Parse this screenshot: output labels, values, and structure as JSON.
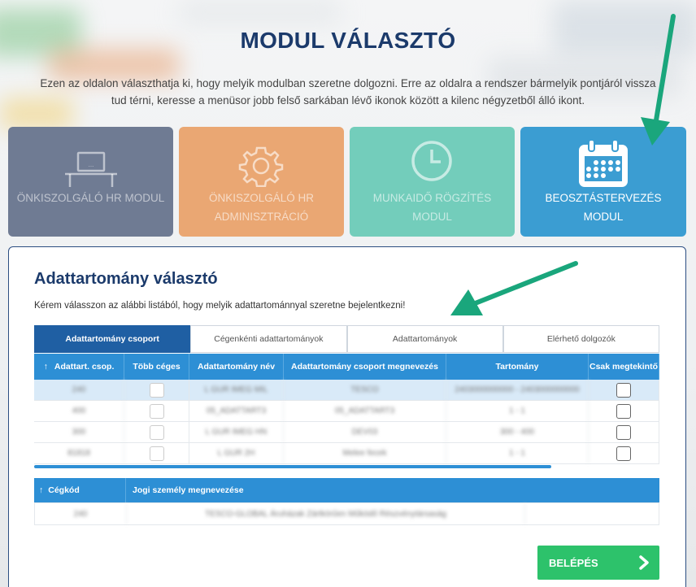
{
  "page": {
    "title": "MODUL VÁLASZTÓ",
    "subtitle": "Ezen az oldalon választhatja ki, hogy melyik modulban szeretne dolgozni. Erre az oldalra a rendszer bármelyik pontjáról vissza tud térni, keresse a menüsor jobb felső sarkában lévő ikonok között a kilenc négyzetből álló ikont."
  },
  "modules": [
    {
      "label": "ÖNKISZOLGÁLÓ HR MODUL",
      "icon": "workstation-icon",
      "color": "#6f7b93"
    },
    {
      "label": "ÖNKISZOLGÁLÓ HR ADMINISZTRÁCIÓ",
      "icon": "gear-icon",
      "color": "#eaa773"
    },
    {
      "label": "MUNKAIDŐ RÖGZÍTÉS MODUL",
      "icon": "clock-icon",
      "color": "#73cdbb"
    },
    {
      "label": "BEOSZTÁSTERVEZÉS MODUL",
      "icon": "calendar-icon",
      "color": "#3b9dd2"
    }
  ],
  "panel": {
    "title": "Adattartomány választó",
    "description": "Kérem válasszon az alábbi listából, hogy melyik adattartománnyal szeretne bejelentkezni!"
  },
  "tabs": [
    {
      "label": "Adattartomány csoport",
      "active": true
    },
    {
      "label": "Cégenkénti adattartományok",
      "active": false
    },
    {
      "label": "Adattartományok",
      "active": false
    },
    {
      "label": "Elérhető dolgozók",
      "active": false
    }
  ],
  "grid": {
    "sort_icon": "↑",
    "columns": [
      "Adattart. csop.",
      "Több céges",
      "Adattartomány név",
      "Adattartomány csoport megnevezés",
      "Tartomány",
      "Csak megtekintő"
    ],
    "rows": [
      {
        "code": "240",
        "name": "L GUR IMEG MIL",
        "group": "TESCO",
        "range": "2403000000000 - 2403000000000"
      },
      {
        "code": "400",
        "name": "05_ADATTART3",
        "group": "05_ADATTART3",
        "range": "1 - 1"
      },
      {
        "code": "300",
        "name": "L GUR IMEG HN",
        "group": "DEV03",
        "range": "300 - 400"
      },
      {
        "code": "81818",
        "name": "L GUR 2H",
        "group": "Melee fecek",
        "range": "1 - 1"
      }
    ]
  },
  "company_grid": {
    "sort_icon": "↑",
    "columns": [
      "Cégkód",
      "Jogi személy megnevezése"
    ],
    "rows": [
      {
        "code": "240",
        "name": "TESCO-GLOBAL Áruházak Zártkörűen Működő Részvénytársaság"
      }
    ]
  },
  "login_button": {
    "label": "BELÉPÉS",
    "icon": "chevron-right-icon"
  },
  "colors": {
    "accent": "#2d8fd5",
    "login": "#2dc26b",
    "title": "#1b3a6b",
    "arrow": "#1aa67c"
  }
}
